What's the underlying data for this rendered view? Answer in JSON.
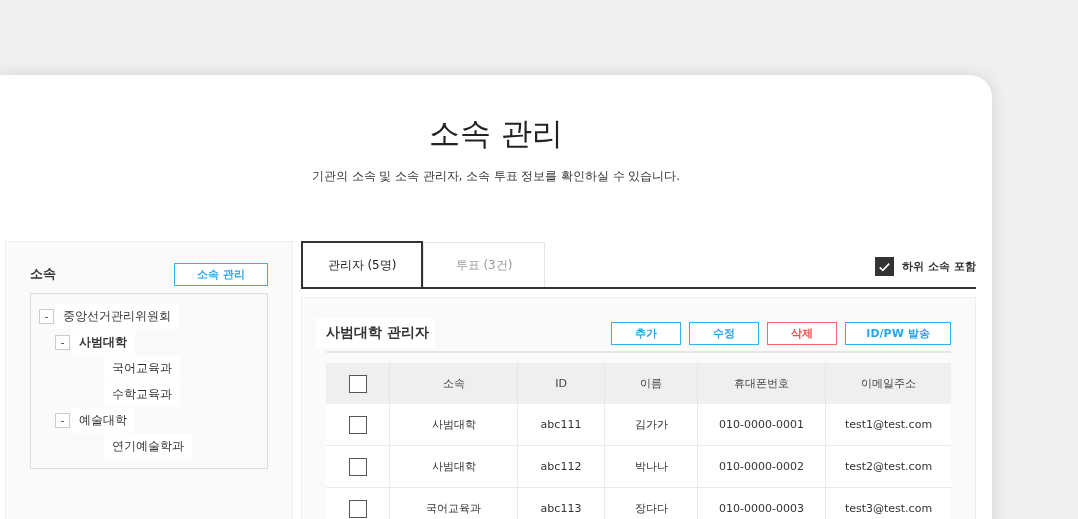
{
  "header": {
    "title": "소속 관리",
    "subtitle": "기관의 소속 및 소속 관리자, 소속 투표 정보를 확인하실 수 있습니다."
  },
  "sidebar": {
    "title": "소속",
    "manage_button": "소속 관리",
    "tree": [
      {
        "label": "중앙선거관리위원회",
        "toggle": "-",
        "expanded": true,
        "selected": false,
        "children": [
          {
            "label": "사범대학",
            "toggle": "-",
            "expanded": true,
            "selected": true,
            "children": [
              {
                "label": "국어교육과",
                "selected": false
              },
              {
                "label": "수학교육과",
                "selected": false
              }
            ]
          },
          {
            "label": "예술대학",
            "toggle": "-",
            "expanded": true,
            "selected": false,
            "children": [
              {
                "label": "연기예술학과",
                "selected": false
              }
            ]
          }
        ]
      }
    ]
  },
  "tabs": [
    {
      "label": "관리자 (5명)",
      "selected": true
    },
    {
      "label": "투표 (3건)",
      "selected": false
    }
  ],
  "include_sub": {
    "label": "하위 소속 포함",
    "checked": true
  },
  "section": {
    "title": "사범대학 관리자",
    "buttons": [
      {
        "label": "추가",
        "kind": "normal"
      },
      {
        "label": "수정",
        "kind": "normal"
      },
      {
        "label": "삭제",
        "kind": "danger"
      },
      {
        "label": "ID/PW 발송",
        "kind": "normal"
      }
    ]
  },
  "table": {
    "select_all_checked": false,
    "columns": [
      "소속",
      "ID",
      "이름",
      "휴대폰번호",
      "이메일주소"
    ],
    "rows": [
      {
        "checked": false,
        "cells": [
          "사범대학",
          "abc111",
          "김가가",
          "010-0000-0001",
          "test1@test.com"
        ]
      },
      {
        "checked": false,
        "cells": [
          "사범대학",
          "abc112",
          "박나나",
          "010-0000-0002",
          "test2@test.com"
        ]
      },
      {
        "checked": false,
        "cells": [
          "국어교육과",
          "abc113",
          "장다다",
          "010-0000-0003",
          "test3@test.com"
        ]
      }
    ]
  }
}
